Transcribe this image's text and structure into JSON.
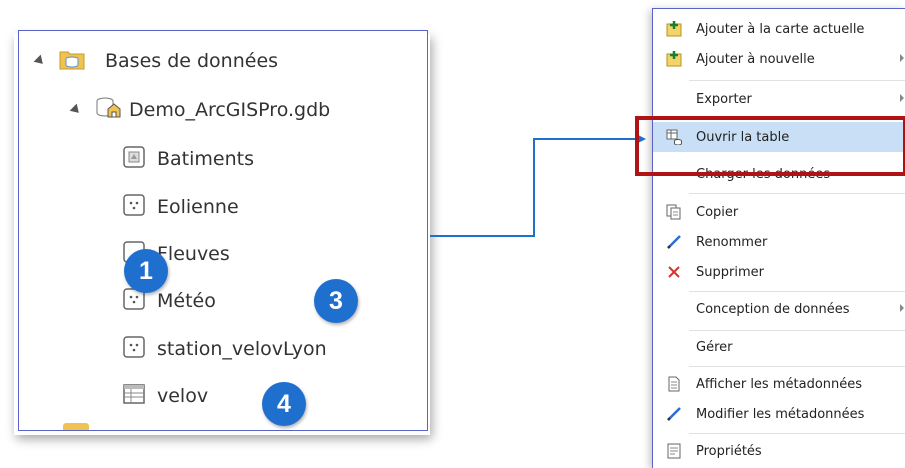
{
  "catalog": {
    "database_folder": "Bases de données",
    "geodatabase": "Demo_ArcGISPro.gdb",
    "items": [
      {
        "label": "Batiments",
        "icon": "polygon-feature-class-icon"
      },
      {
        "label": "Eolienne",
        "icon": "point-feature-class-icon"
      },
      {
        "label": "Fleuves",
        "icon": "line-feature-class-icon"
      },
      {
        "label": "Météo",
        "icon": "point-feature-class-icon"
      },
      {
        "label": "station_velovLyon",
        "icon": "point-feature-class-icon"
      },
      {
        "label": "velov",
        "icon": "table-icon"
      }
    ]
  },
  "badges": [
    "1",
    "3",
    "4"
  ],
  "context_menu": {
    "items": [
      {
        "label": "Ajouter à la carte actuelle",
        "icon": "add-to-map-icon"
      },
      {
        "label": "Ajouter à nouvelle",
        "icon": "add-to-new-icon"
      },
      {
        "label": "Exporter",
        "icon": ""
      },
      {
        "label": "Ouvrir la table",
        "icon": "open-table-icon"
      },
      {
        "label": "Charger les données",
        "icon": ""
      },
      {
        "label": "Copier",
        "icon": "copy-icon"
      },
      {
        "label": "Renommer",
        "icon": "rename-pencil-icon"
      },
      {
        "label": "Supprimer",
        "icon": "delete-x-icon"
      },
      {
        "label": "Conception de données",
        "icon": ""
      },
      {
        "label": "Gérer",
        "icon": ""
      },
      {
        "label": "Afficher les métadonnées",
        "icon": "metadata-document-icon"
      },
      {
        "label": "Modifier les métadonnées",
        "icon": "edit-metadata-pencil-icon"
      },
      {
        "label": "Propriétés",
        "icon": "properties-icon"
      }
    ]
  },
  "colors": {
    "badge": "#1f6fcf",
    "highlight_box": "#b01313",
    "connector": "#1f6fcf",
    "panel_border": "#5a63c8",
    "selected_item": "#c9dff5"
  }
}
